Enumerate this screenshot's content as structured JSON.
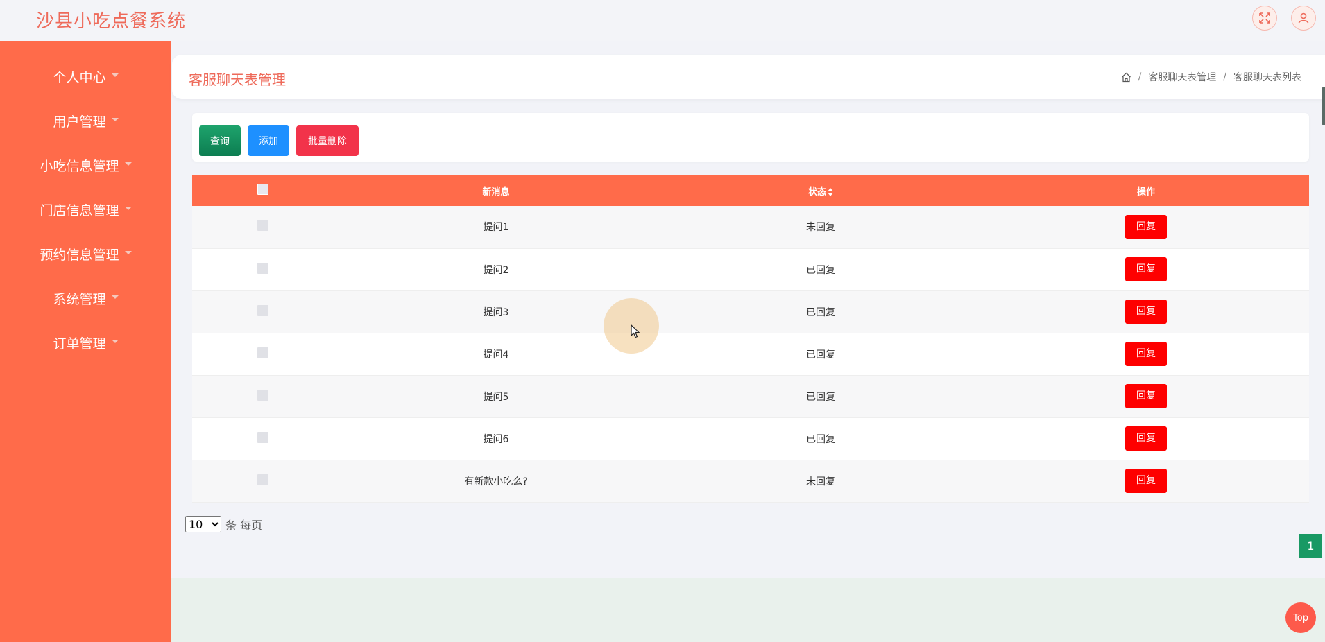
{
  "app": {
    "title": "沙县小吃点餐系统"
  },
  "top_icons": [
    "fullscreen-icon",
    "user-icon"
  ],
  "sidebar": {
    "items": [
      {
        "label": "个人中心"
      },
      {
        "label": "用户管理"
      },
      {
        "label": "小吃信息管理"
      },
      {
        "label": "门店信息管理"
      },
      {
        "label": "预约信息管理"
      },
      {
        "label": "系统管理"
      },
      {
        "label": "订单管理"
      }
    ]
  },
  "header": {
    "title": "客服聊天表管理",
    "breadcrumb": [
      "客服聊天表管理",
      "客服聊天表列表"
    ]
  },
  "toolbar": {
    "search_label": "查询",
    "add_label": "添加",
    "batch_delete_label": "批量删除"
  },
  "table": {
    "columns": {
      "message": "新消息",
      "status": "状态",
      "operation": "操作"
    },
    "reply_label": "回复",
    "rows": [
      {
        "message": "提问1",
        "status": "未回复"
      },
      {
        "message": "提问2",
        "status": "已回复"
      },
      {
        "message": "提问3",
        "status": "已回复"
      },
      {
        "message": "提问4",
        "status": "已回复"
      },
      {
        "message": "提问5",
        "status": "已回复"
      },
      {
        "message": "提问6",
        "status": "已回复"
      },
      {
        "message": "有新款小吃么?",
        "status": "未回复"
      }
    ]
  },
  "pagination": {
    "page_size": "10",
    "page_size_options": [
      "10"
    ],
    "per_page_label": "条 每页",
    "current_page": "1"
  },
  "back_to_top": {
    "label": "Top"
  },
  "colors": {
    "primary": "#ff6b4a",
    "title": "#ee6a5a",
    "reply": "#fe0000",
    "search": "#0c7d51",
    "add": "#1e90ff",
    "batch_delete": "#f2334a",
    "page": "#199964"
  }
}
